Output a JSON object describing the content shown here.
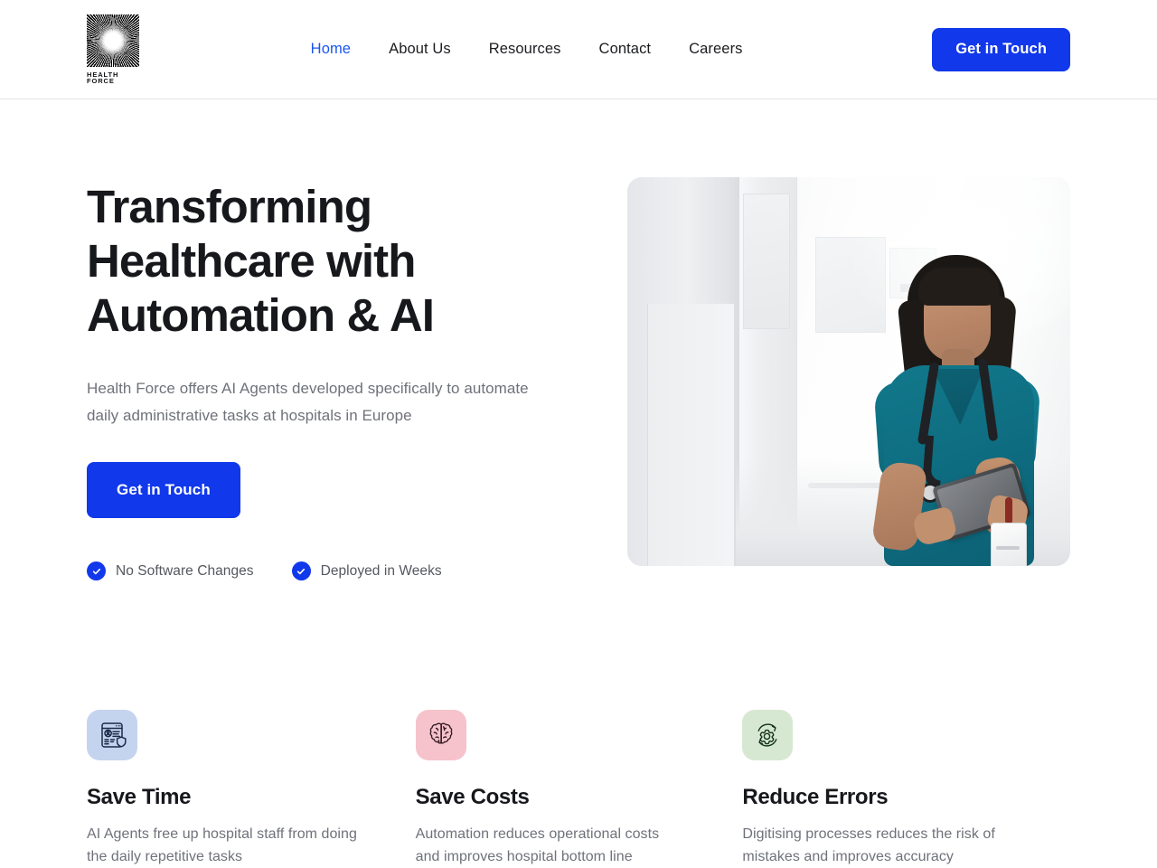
{
  "brand": {
    "name": "HEALTH FORCE",
    "logo_icon": "sunburst-logo-icon"
  },
  "header": {
    "nav": [
      {
        "label": "Home",
        "active": true
      },
      {
        "label": "About Us",
        "active": false
      },
      {
        "label": "Resources",
        "active": false
      },
      {
        "label": "Contact",
        "active": false
      },
      {
        "label": "Careers",
        "active": false
      }
    ],
    "cta_label": "Get in Touch"
  },
  "hero": {
    "title": "Transforming Healthcare with Automation & AI",
    "subtitle": "Health Force offers AI Agents developed specifically to automate daily administrative tasks at hospitals in Europe",
    "cta_label": "Get in Touch",
    "badges": [
      {
        "label": "No Software Changes",
        "icon": "check-circle-icon"
      },
      {
        "label": "Deployed in Weeks",
        "icon": "check-circle-icon"
      }
    ],
    "image_alt": "Nurse in teal scrubs with stethoscope using a tablet in a bright hospital corridor"
  },
  "features": [
    {
      "title": "Save Time",
      "description": "AI Agents free up hospital staff from doing the daily repetitive tasks",
      "icon": "document-profile-shield-icon",
      "icon_bg": "#c5d4ee",
      "icon_stroke": "#1b2a4a"
    },
    {
      "title": "Save Costs",
      "description": "Automation reduces operational costs and improves hospital bottom line",
      "icon": "brain-icon",
      "icon_bg": "#f6c3cc",
      "icon_stroke": "#3a1e26"
    },
    {
      "title": "Reduce Errors",
      "description": "Digitising processes reduces the risk of mistakes and improves accuracy",
      "icon": "gear-refresh-icon",
      "icon_bg": "#d7e8d2",
      "icon_stroke": "#14331a"
    }
  ],
  "colors": {
    "accent_blue": "#1138ea",
    "nav_active": "#1a56f0",
    "heading": "#17181c",
    "body_text": "#6f727a",
    "border": "#e2e4e8"
  }
}
